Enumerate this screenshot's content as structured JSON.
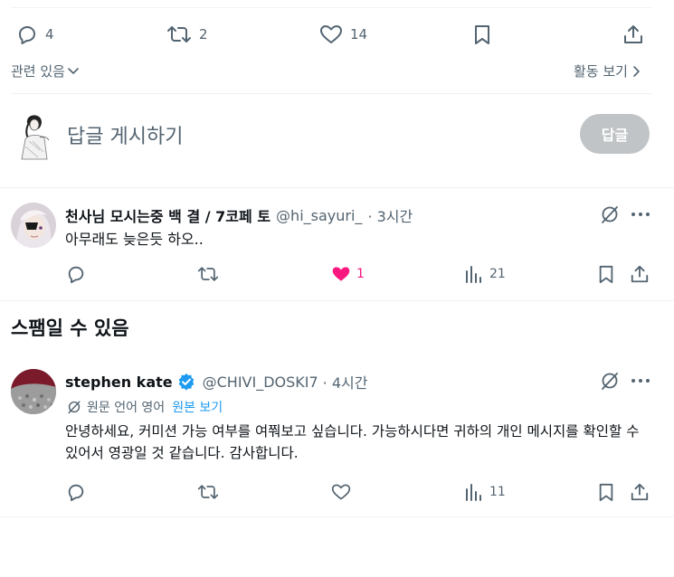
{
  "main_tweet_actions": {
    "reply_count": "4",
    "retweet_count": "2",
    "like_count": "14"
  },
  "related": {
    "label": "관련 있음",
    "view_activity": "활동 보기"
  },
  "composer": {
    "placeholder": "답글 게시하기",
    "reply_button": "답글"
  },
  "replies": [
    {
      "display_name": "천사님 모시는중 백 결 / 7코페 토",
      "handle": "@hi_sayuri_",
      "time": "· 3시간",
      "text": "아무래도 늦은듯 하오..",
      "like_count": "1",
      "view_count": "21",
      "liked": true
    },
    {
      "display_name": "stephen kate",
      "handle": "@CHIVI_DOSKI7",
      "time": "· 4시간",
      "translation_note": "원문 언어 영어",
      "show_original": "원본 보기",
      "text": "안녕하세요, 커미션 가능 여부를 여쭤보고 싶습니다. 가능하시다면 귀하의 개인 메시지를 확인할 수 있어서 영광일 것 같습니다. 감사합니다.",
      "view_count": "11",
      "verified": true
    }
  ],
  "spam_section": {
    "title": "스팸일 수 있음"
  },
  "colors": {
    "like_pink": "#f91880",
    "verified_blue": "#1d9bf0",
    "link_blue": "#1d9bf0",
    "muted_text": "#536471",
    "divider": "#eff3f4",
    "reply_button_disabled": "#c0c4c7"
  }
}
